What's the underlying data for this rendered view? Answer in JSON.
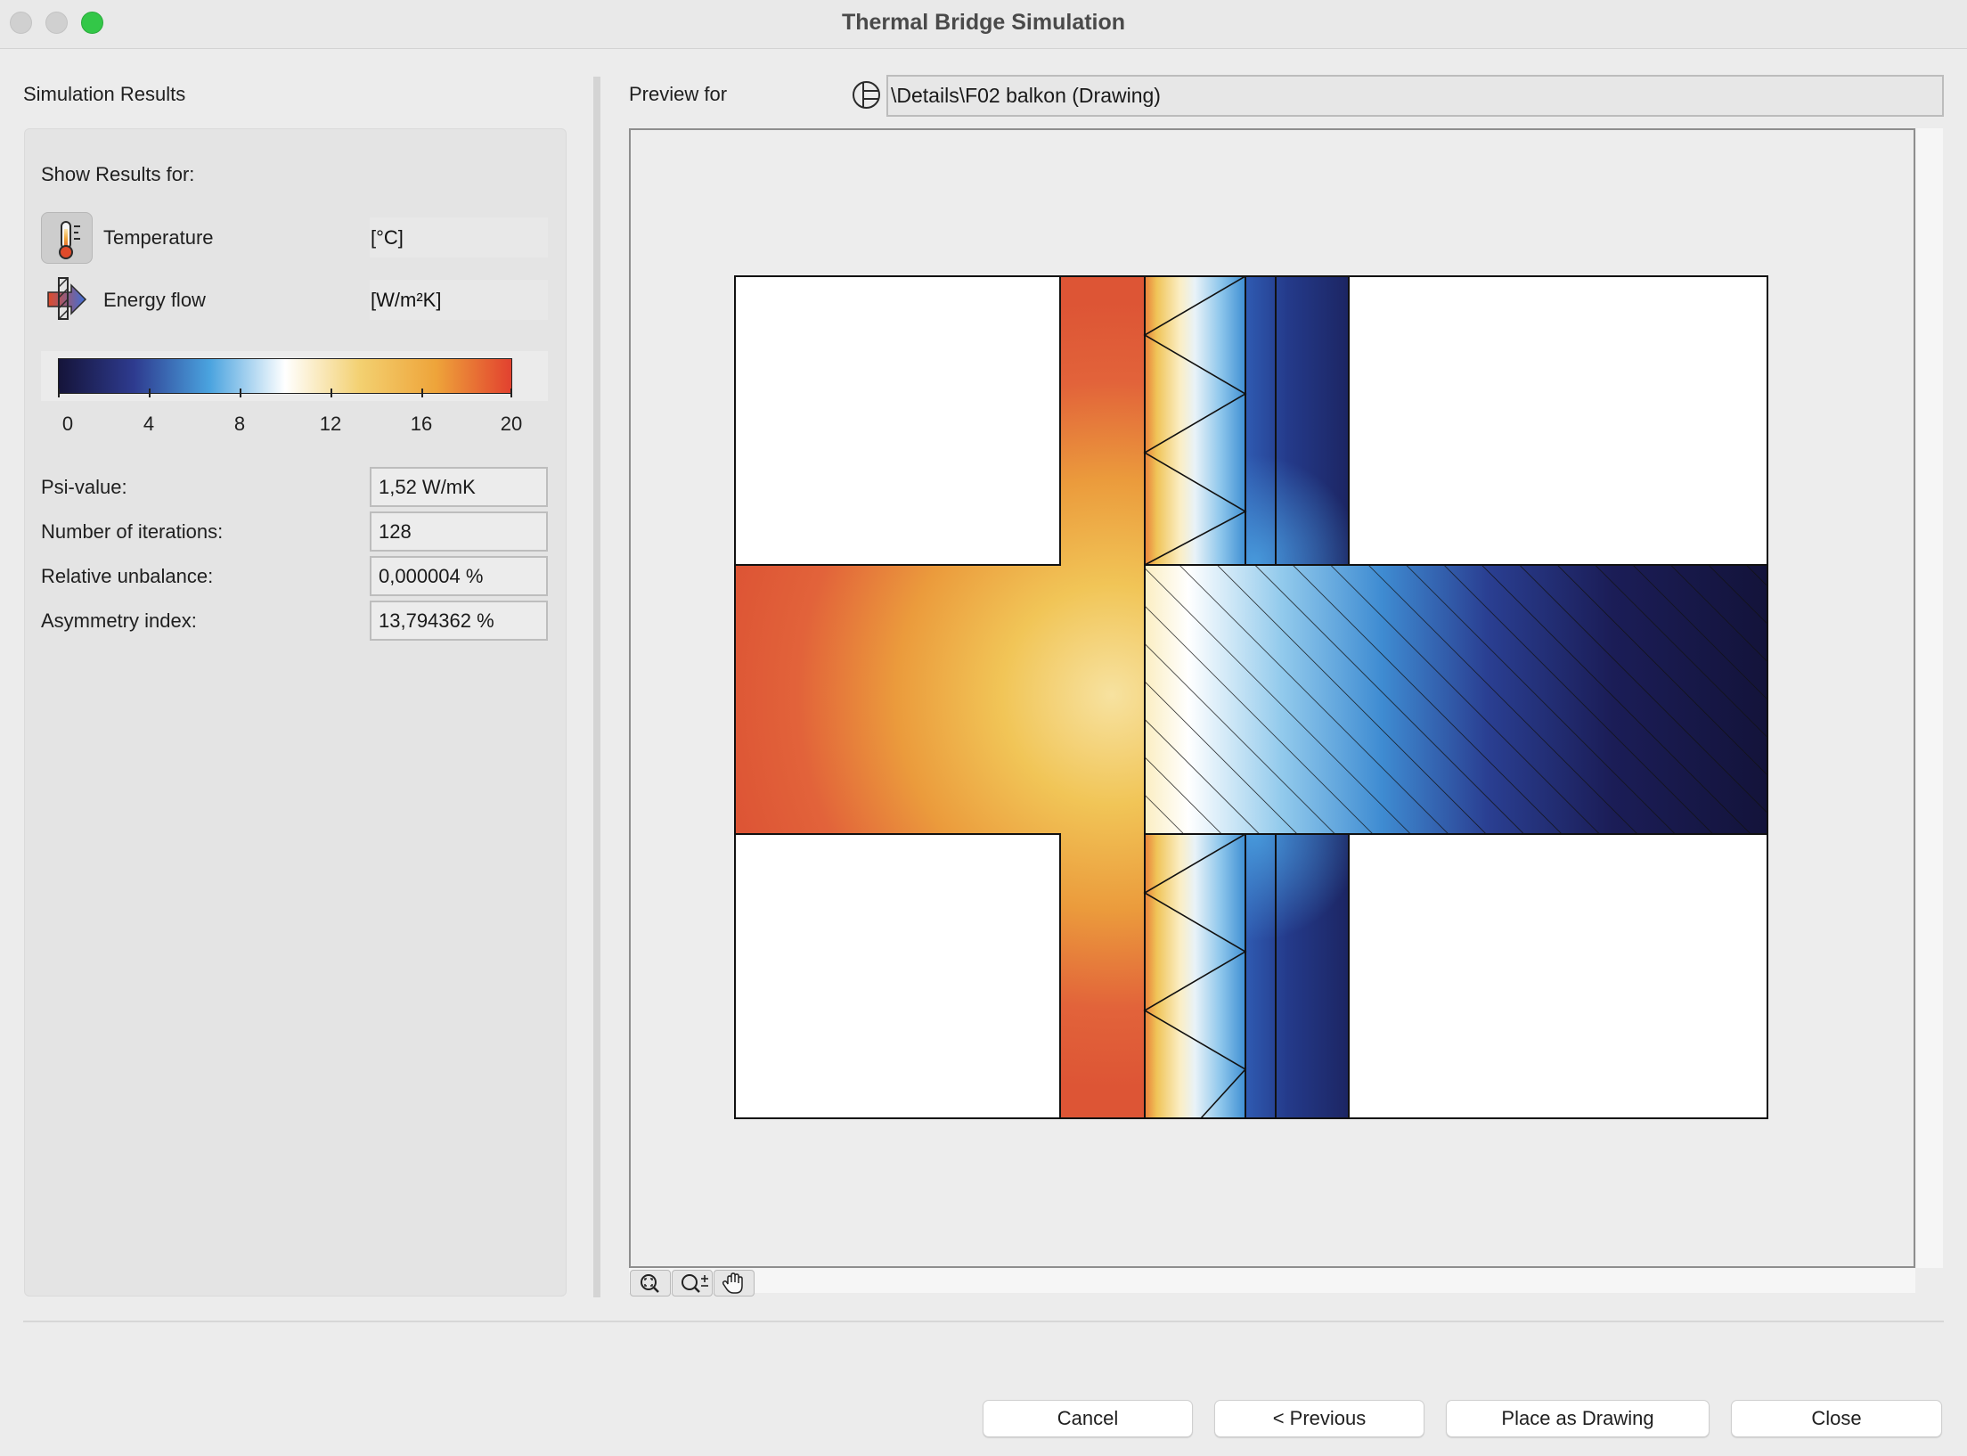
{
  "window": {
    "title": "Thermal Bridge Simulation"
  },
  "left_panel": {
    "section_title": "Simulation Results",
    "show_results_label": "Show Results for:",
    "options": [
      {
        "label": "Temperature",
        "unit": "[°C]",
        "icon": "thermometer-icon",
        "selected": true
      },
      {
        "label": "Energy flow",
        "unit": "[W/m²K]",
        "icon": "energy-flow-icon",
        "selected": false
      }
    ],
    "color_scale": {
      "ticks": [
        "0",
        "4",
        "8",
        "12",
        "16",
        "20"
      ],
      "colors": [
        "#15143a",
        "#2e3b8f",
        "#4aa3df",
        "#ffffff",
        "#f3d070",
        "#eea43a",
        "#e2412f"
      ]
    },
    "results": [
      {
        "label": "Psi-value:",
        "value": "1,52 W/mK"
      },
      {
        "label": "Number of iterations:",
        "value": "128"
      },
      {
        "label": "Relative unbalance:",
        "value": "0,000004 %"
      },
      {
        "label": "Asymmetry index:",
        "value": "13,794362 %"
      }
    ]
  },
  "preview": {
    "label": "Preview for",
    "path": "\\Details\\F02 balkon (Drawing)",
    "tools": [
      "zoom-fit-icon",
      "zoom-in-icon",
      "pan-hand-icon"
    ]
  },
  "buttons": {
    "cancel": "Cancel",
    "previous": "< Previous",
    "place": "Place as Drawing",
    "close": "Close"
  }
}
